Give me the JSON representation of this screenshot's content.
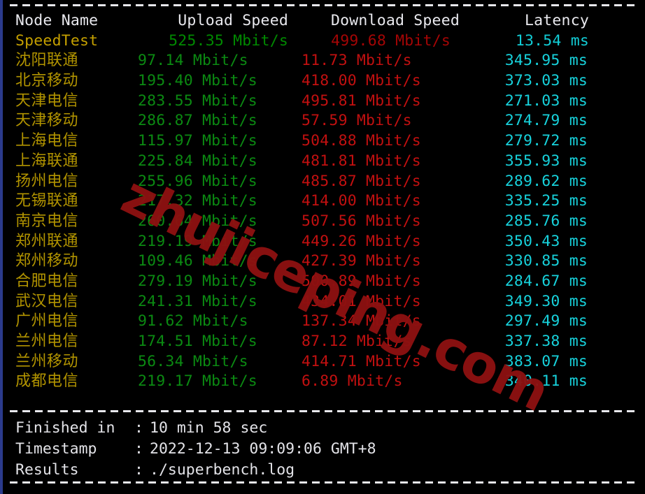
{
  "terminal": {
    "accent_border": "#2b3a8c",
    "background": "#000000"
  },
  "watermark": {
    "text": "zhujiceping.com",
    "color": "#8d1111"
  },
  "colors": {
    "header": "#e9e9ee",
    "node_name": "#b29400",
    "upload": "#0b8a12",
    "download": "#c21010",
    "latency": "#17d2dc",
    "footer": "#e3e3e8"
  },
  "table": {
    "headers": {
      "node": "Node Name",
      "upload": "Upload Speed",
      "download": "Download Speed",
      "latency": "Latency"
    },
    "summary": {
      "node": "SpeedTest",
      "upload": "525.35 Mbit/s",
      "download": "499.68 Mbit/s",
      "latency": "13.54 ms"
    },
    "rows": [
      {
        "node": "沈阳联通",
        "upload": "97.14 Mbit/s",
        "download": "11.73 Mbit/s",
        "latency": "345.95 ms"
      },
      {
        "node": "北京移动",
        "upload": "195.40 Mbit/s",
        "download": "418.00 Mbit/s",
        "latency": "373.03 ms"
      },
      {
        "node": "天津电信",
        "upload": "283.55 Mbit/s",
        "download": "495.81 Mbit/s",
        "latency": "271.03 ms"
      },
      {
        "node": "天津移动",
        "upload": "286.87 Mbit/s",
        "download": "57.59 Mbit/s",
        "latency": "274.79 ms"
      },
      {
        "node": "上海电信",
        "upload": "115.97 Mbit/s",
        "download": "504.88 Mbit/s",
        "latency": "279.72 ms"
      },
      {
        "node": "上海联通",
        "upload": "225.84 Mbit/s",
        "download": "481.81 Mbit/s",
        "latency": "355.93 ms"
      },
      {
        "node": "扬州电信",
        "upload": "255.96 Mbit/s",
        "download": "485.87 Mbit/s",
        "latency": "289.62 ms"
      },
      {
        "node": "无锡联通",
        "upload": "217.32 Mbit/s",
        "download": "414.00 Mbit/s",
        "latency": "335.25 ms"
      },
      {
        "node": "南京电信",
        "upload": "260.64 Mbit/s",
        "download": "507.56 Mbit/s",
        "latency": "285.76 ms"
      },
      {
        "node": "郑州联通",
        "upload": "219.19 Mbit/s",
        "download": "449.26 Mbit/s",
        "latency": "350.43 ms"
      },
      {
        "node": "郑州移动",
        "upload": "109.46 Mbit/s",
        "download": "427.39 Mbit/s",
        "latency": "330.85 ms"
      },
      {
        "node": "合肥电信",
        "upload": "279.19 Mbit/s",
        "download": "500.89 Mbit/s",
        "latency": "284.67 ms"
      },
      {
        "node": "武汉电信",
        "upload": "241.31 Mbit/s",
        "download": "434.01 Mbit/s",
        "latency": "349.30 ms"
      },
      {
        "node": "广州电信",
        "upload": "91.62 Mbit/s",
        "download": "137.34 Mbit/s",
        "latency": "297.49 ms"
      },
      {
        "node": "兰州电信",
        "upload": "174.51 Mbit/s",
        "download": "87.12 Mbit/s",
        "latency": "337.38 ms"
      },
      {
        "node": "兰州移动",
        "upload": "56.34 Mbit/s",
        "download": "414.71 Mbit/s",
        "latency": "383.07 ms"
      },
      {
        "node": "成都电信",
        "upload": "219.17 Mbit/s",
        "download": "6.89 Mbit/s",
        "latency": "340.11 ms"
      }
    ]
  },
  "footer": {
    "lines": [
      {
        "label": "Finished in",
        "sep": ":",
        "value": "10 min 58 sec"
      },
      {
        "label": "Timestamp",
        "sep": ":",
        "value": "2022-12-13 09:09:06 GMT+8"
      },
      {
        "label": "Results",
        "sep": ":",
        "value": "./superbench.log"
      }
    ]
  }
}
